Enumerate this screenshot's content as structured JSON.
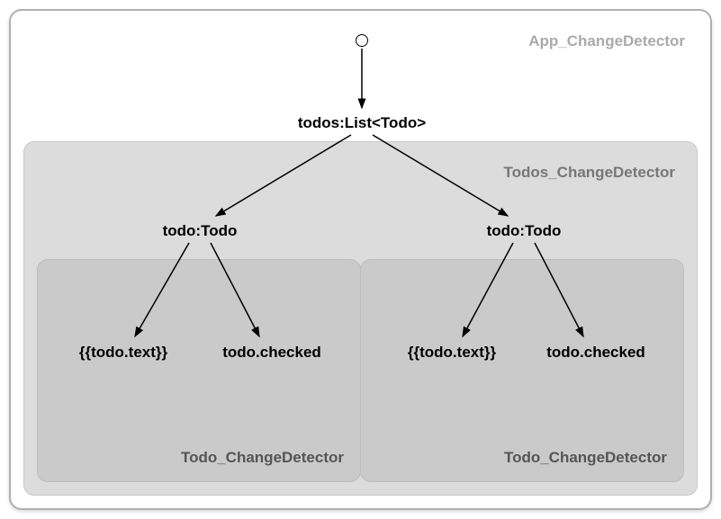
{
  "app": {
    "label": "App_ChangeDetector"
  },
  "todos_box": {
    "label": "Todos_ChangeDetector"
  },
  "root_node": "todos:List<Todo>",
  "todo_node_left": "todo:Todo",
  "todo_node_right": "todo:Todo",
  "leaf_text": "{{todo.text}}",
  "leaf_checked": "todo.checked",
  "inner_label": "Todo_ChangeDetector"
}
